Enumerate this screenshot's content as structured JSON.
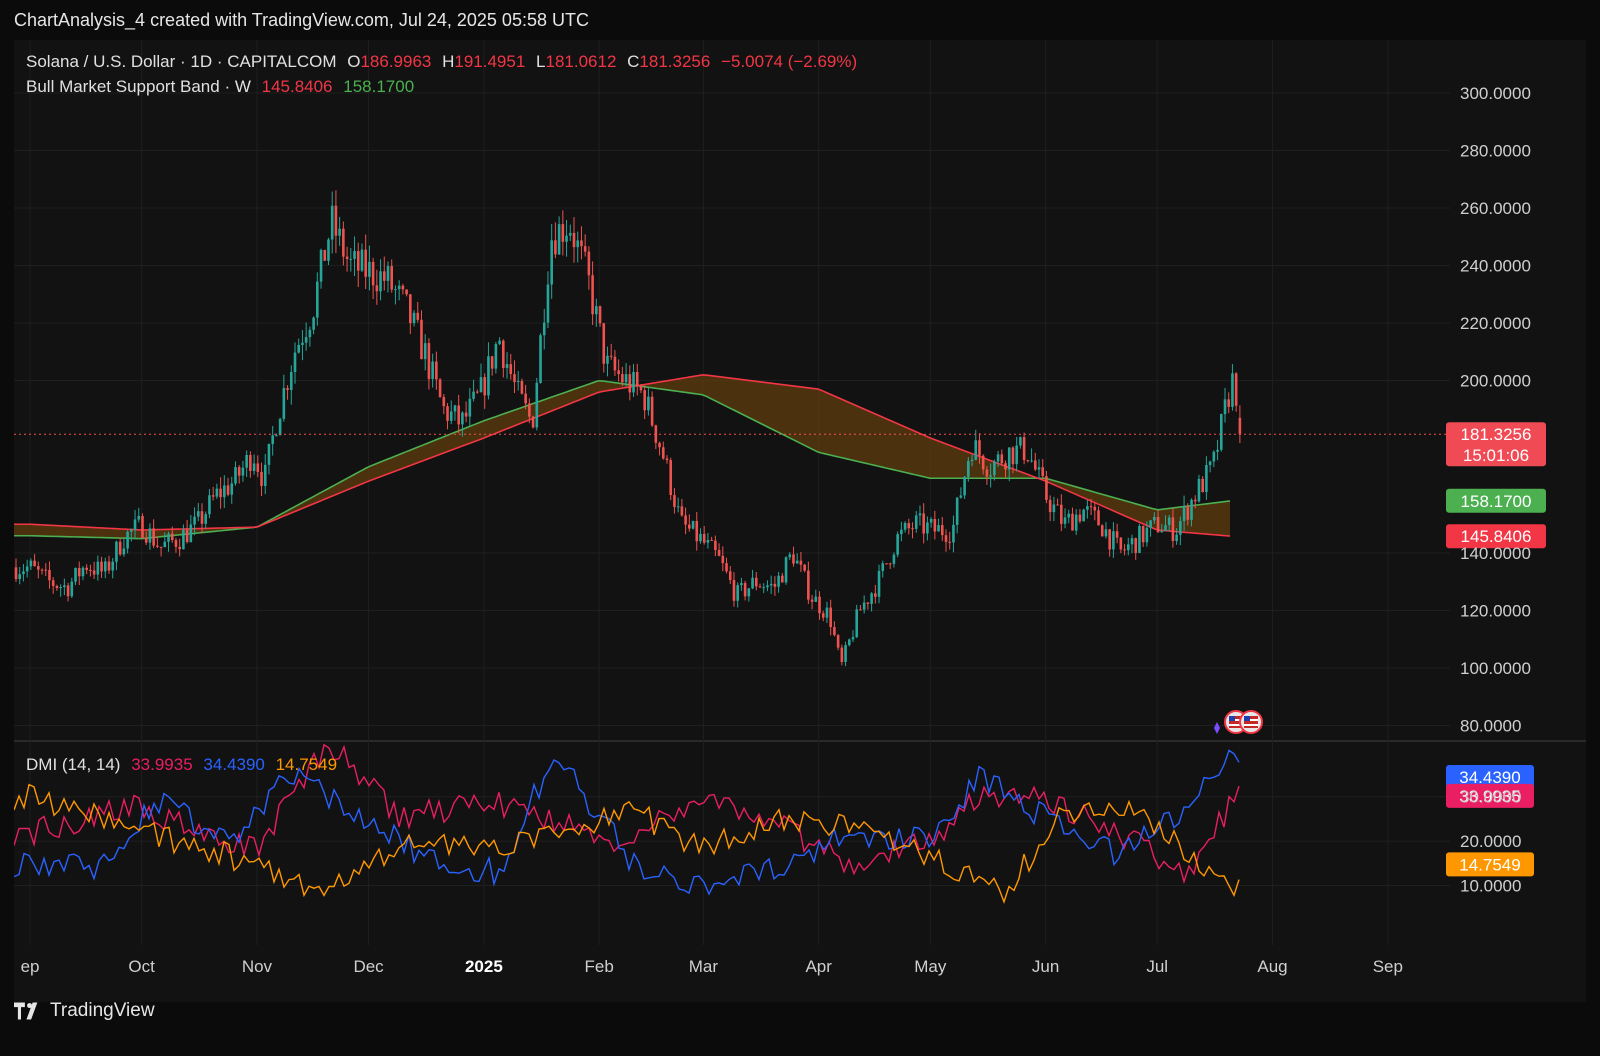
{
  "header": {
    "title": "ChartAnalysis_4 created with TradingView.com, Jul 24, 2025 05:58 UTC"
  },
  "legend": {
    "symbol": "Solana / U.S. Dollar · 1D · CAPITALCOM",
    "o_label": "O",
    "o_value": "186.9963",
    "h_label": "H",
    "h_value": "191.4951",
    "l_label": "L",
    "l_value": "181.0612",
    "c_label": "C",
    "c_value": "181.3256",
    "change": "−5.0074 (−2.69%)",
    "band_label": "Bull Market Support Band · W",
    "band_lower": "145.8406",
    "band_upper": "158.1700"
  },
  "dmi_legend": {
    "label": "DMI (14, 14)",
    "adx": "33.9935",
    "plus_di": "34.4390",
    "minus_di": "14.7549"
  },
  "footer": {
    "brand": "TradingView"
  },
  "colors": {
    "up": "#26a69a",
    "down": "#ef5350",
    "band_upper": "#4caf50",
    "band_lower": "#f23645",
    "band_fill": "#5a3a0e",
    "adx": "#e91e63",
    "plus_di": "#2962ff",
    "minus_di": "#ff9800"
  },
  "chart_data": [
    {
      "type": "candlestick",
      "title": "Solana / U.S. Dollar · 1D · CAPITALCOM",
      "price_axis": {
        "ticks": [
          "300.0000",
          "280.0000",
          "260.0000",
          "240.0000",
          "220.0000",
          "200.0000",
          "140.0000",
          "120.0000",
          "100.0000",
          "80.0000"
        ],
        "ylim": [
          80,
          300
        ]
      },
      "time_axis": {
        "ticks": [
          "ep",
          "Oct",
          "Nov",
          "Dec",
          "2025",
          "Feb",
          "Mar",
          "Apr",
          "May",
          "Jun",
          "Jul",
          "Aug",
          "Sep"
        ],
        "bold": "2025"
      },
      "last_price": {
        "value": 181.3256,
        "label": "181.3256",
        "countdown": "15:01:06"
      },
      "price_path": [
        [
          "2024-09-01",
          135
        ],
        [
          "2024-09-06",
          130
        ],
        [
          "2024-09-11",
          128
        ],
        [
          "2024-09-16",
          136
        ],
        [
          "2024-09-21",
          133
        ],
        [
          "2024-09-26",
          145
        ],
        [
          "2024-10-01",
          150
        ],
        [
          "2024-10-06",
          142
        ],
        [
          "2024-10-11",
          145
        ],
        [
          "2024-10-16",
          150
        ],
        [
          "2024-10-21",
          160
        ],
        [
          "2024-10-26",
          165
        ],
        [
          "2024-10-31",
          175
        ],
        [
          "2024-11-03",
          165
        ],
        [
          "2024-11-06",
          185
        ],
        [
          "2024-11-11",
          210
        ],
        [
          "2024-11-16",
          225
        ],
        [
          "2024-11-21",
          255
        ],
        [
          "2024-11-26",
          240
        ],
        [
          "2024-12-01",
          238
        ],
        [
          "2024-12-06",
          235
        ],
        [
          "2024-12-11",
          225
        ],
        [
          "2024-12-16",
          210
        ],
        [
          "2024-12-21",
          190
        ],
        [
          "2024-12-26",
          185
        ],
        [
          "2024-12-31",
          195
        ],
        [
          "2025-01-05",
          215
        ],
        [
          "2025-01-10",
          195
        ],
        [
          "2025-01-14",
          185
        ],
        [
          "2025-01-19",
          250
        ],
        [
          "2025-01-24",
          255
        ],
        [
          "2025-01-29",
          235
        ],
        [
          "2025-02-03",
          205
        ],
        [
          "2025-02-08",
          200
        ],
        [
          "2025-02-13",
          195
        ],
        [
          "2025-02-18",
          175
        ],
        [
          "2025-02-23",
          150
        ],
        [
          "2025-02-28",
          145
        ],
        [
          "2025-03-05",
          138
        ],
        [
          "2025-03-10",
          125
        ],
        [
          "2025-03-15",
          130
        ],
        [
          "2025-03-20",
          128
        ],
        [
          "2025-03-25",
          140
        ],
        [
          "2025-03-30",
          125
        ],
        [
          "2025-04-04",
          118
        ],
        [
          "2025-04-07",
          100
        ],
        [
          "2025-04-12",
          120
        ],
        [
          "2025-04-17",
          130
        ],
        [
          "2025-04-22",
          145
        ],
        [
          "2025-04-27",
          150
        ],
        [
          "2025-05-02",
          148
        ],
        [
          "2025-05-07",
          148
        ],
        [
          "2025-05-12",
          178
        ],
        [
          "2025-05-17",
          170
        ],
        [
          "2025-05-22",
          175
        ],
        [
          "2025-05-27",
          176
        ],
        [
          "2025-06-01",
          160
        ],
        [
          "2025-06-06",
          150
        ],
        [
          "2025-06-11",
          155
        ],
        [
          "2025-06-16",
          150
        ],
        [
          "2025-06-21",
          140
        ],
        [
          "2025-06-26",
          145
        ],
        [
          "2025-07-01",
          150
        ],
        [
          "2025-07-06",
          148
        ],
        [
          "2025-07-11",
          160
        ],
        [
          "2025-07-16",
          170
        ],
        [
          "2025-07-21",
          200
        ],
        [
          "2025-07-22",
          198
        ],
        [
          "2025-07-24",
          181.3256
        ]
      ],
      "series": [
        {
          "name": "Bull Market Support Band upper",
          "x": [
            "2024-09-01",
            "2024-10-01",
            "2024-11-01",
            "2024-12-01",
            "2025-01-01",
            "2025-02-01",
            "2025-03-01",
            "2025-04-01",
            "2025-05-01",
            "2025-06-01",
            "2025-07-01",
            "2025-07-21"
          ],
          "values": [
            146,
            145,
            149,
            170,
            186,
            200,
            195,
            175,
            166,
            166,
            155,
            158.17
          ]
        },
        {
          "name": "Bull Market Support Band lower",
          "x": [
            "2024-09-01",
            "2024-10-01",
            "2024-11-01",
            "2024-12-01",
            "2025-01-01",
            "2025-02-01",
            "2025-03-01",
            "2025-04-01",
            "2025-05-01",
            "2025-06-01",
            "2025-07-01",
            "2025-07-21"
          ],
          "values": [
            150,
            148,
            149,
            165,
            180,
            196,
            202,
            197,
            180,
            165,
            148,
            145.84
          ]
        }
      ]
    },
    {
      "type": "line",
      "title": "DMI (14, 14)",
      "ylim": [
        3,
        43
      ],
      "y_ticks": [
        "30.0000",
        "20.0000",
        "10.0000"
      ],
      "series": [
        {
          "name": "ADX",
          "x": [
            "2024-09-01",
            "2024-10-01",
            "2024-10-20",
            "2024-11-01",
            "2024-11-20",
            "2024-12-10",
            "2025-01-01",
            "2025-01-20",
            "2025-02-05",
            "2025-03-01",
            "2025-03-20",
            "2025-04-10",
            "2025-05-01",
            "2025-05-15",
            "2025-06-01",
            "2025-06-20",
            "2025-07-10",
            "2025-07-24"
          ],
          "values": [
            22,
            28,
            20,
            18,
            42,
            25,
            29,
            25,
            19,
            30,
            24,
            15,
            20,
            31,
            30,
            22,
            12,
            33.99
          ]
        },
        {
          "name": "+DI",
          "x": [
            "2024-09-01",
            "2024-09-20",
            "2024-10-05",
            "2024-10-25",
            "2024-11-10",
            "2024-12-01",
            "2024-12-20",
            "2025-01-05",
            "2025-01-20",
            "2025-02-10",
            "2025-03-01",
            "2025-03-20",
            "2025-04-10",
            "2025-05-01",
            "2025-05-15",
            "2025-06-01",
            "2025-06-20",
            "2025-07-10",
            "2025-07-22",
            "2025-07-24"
          ],
          "values": [
            15,
            14,
            29,
            20,
            36,
            24,
            15,
            13,
            40,
            15,
            10,
            14,
            22,
            20,
            35,
            25,
            17,
            28,
            41,
            34.44
          ]
        },
        {
          "name": "−DI",
          "x": [
            "2024-09-01",
            "2024-09-20",
            "2024-10-10",
            "2024-11-01",
            "2024-11-20",
            "2024-12-10",
            "2025-01-01",
            "2025-01-20",
            "2025-02-10",
            "2025-03-01",
            "2025-03-20",
            "2025-04-10",
            "2025-05-01",
            "2025-05-20",
            "2025-06-05",
            "2025-06-20",
            "2025-07-05",
            "2025-07-22",
            "2025-07-24"
          ],
          "values": [
            30,
            25,
            20,
            15,
            8,
            20,
            18,
            22,
            27,
            18,
            25,
            23,
            16,
            8,
            25,
            28,
            21,
            8,
            14.75
          ]
        }
      ]
    }
  ]
}
